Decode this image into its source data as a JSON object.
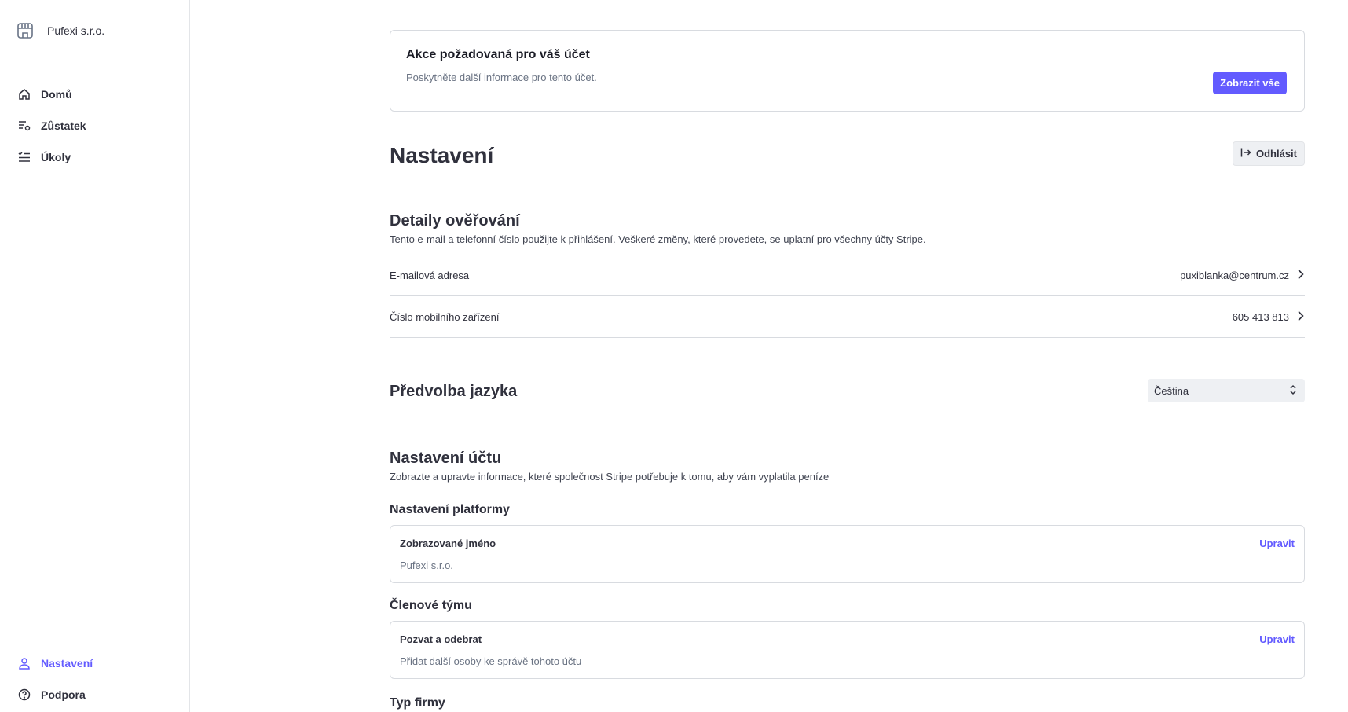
{
  "brand": {
    "name": "Pufexi s.r.o.",
    "icon": "store-icon"
  },
  "sidebar": {
    "items": [
      {
        "label": "Domů",
        "icon": "home-icon"
      },
      {
        "label": "Zůstatek",
        "icon": "balance-icon"
      },
      {
        "label": "Úkoly",
        "icon": "tasks-icon"
      }
    ],
    "bottom_items": [
      {
        "label": "Nastavení",
        "icon": "user-icon",
        "active": true
      },
      {
        "label": "Podpora",
        "icon": "help-icon",
        "active": false
      }
    ]
  },
  "alert": {
    "title": "Akce požadovaná pro váš účet",
    "subtitle": "Poskytněte další informace pro tento účet.",
    "button_label": "Zobrazit vše"
  },
  "page": {
    "title": "Nastavení",
    "logout_label": "Odhlásit"
  },
  "verification": {
    "title": "Detaily ověřování",
    "subtitle": "Tento e-mail a telefonní číslo použijte k přihlášení. Veškeré změny, které provedete, se uplatní pro všechny účty Stripe.",
    "rows": [
      {
        "label": "E-mailová adresa",
        "value": "puxiblanka@centrum.cz"
      },
      {
        "label": "Číslo mobilního zařízení",
        "value": "605 413 813"
      }
    ]
  },
  "language": {
    "title": "Předvolba jazyka",
    "selected": "Čeština"
  },
  "account": {
    "title": "Nastavení účtu",
    "subtitle": "Zobrazte a upravte informace, které společnost Stripe potřebuje k tomu, aby vám vyplatila peníze",
    "platform": {
      "heading": "Nastavení platformy",
      "field_title": "Zobrazované jméno",
      "field_value": "Pufexi s.r.o.",
      "edit_label": "Upravit"
    },
    "team": {
      "heading": "Členové týmu",
      "field_title": "Pozvat a odebrat",
      "field_value": "Přidat další osoby ke správě tohoto účtu",
      "edit_label": "Upravit"
    },
    "company_type": {
      "heading": "Typ firmy"
    }
  },
  "colors": {
    "accent": "#635bff",
    "text": "#30313d",
    "muted": "#6a7383",
    "border": "#d8dbe0"
  }
}
